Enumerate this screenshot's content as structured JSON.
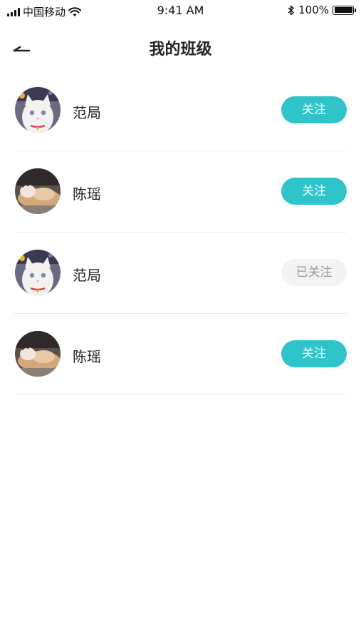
{
  "status_bar": {
    "carrier": "中国移动",
    "time": "9:41 AM",
    "battery": "100%"
  },
  "header": {
    "title": "我的班级"
  },
  "members": [
    {
      "name": "范局",
      "avatar": "white-cat-avatar",
      "button": "关注",
      "followed": false
    },
    {
      "name": "陈瑶",
      "avatar": "sleeping-cat-avatar",
      "button": "关注",
      "followed": false
    },
    {
      "name": "范局",
      "avatar": "white-cat-avatar",
      "button": "已关注",
      "followed": true
    },
    {
      "name": "陈瑶",
      "avatar": "sleeping-cat-avatar",
      "button": "关注",
      "followed": false
    }
  ],
  "colors": {
    "accent": "#2ec4c9",
    "followed_bg": "#f2f3f5",
    "followed_text": "#9a9a9a"
  }
}
